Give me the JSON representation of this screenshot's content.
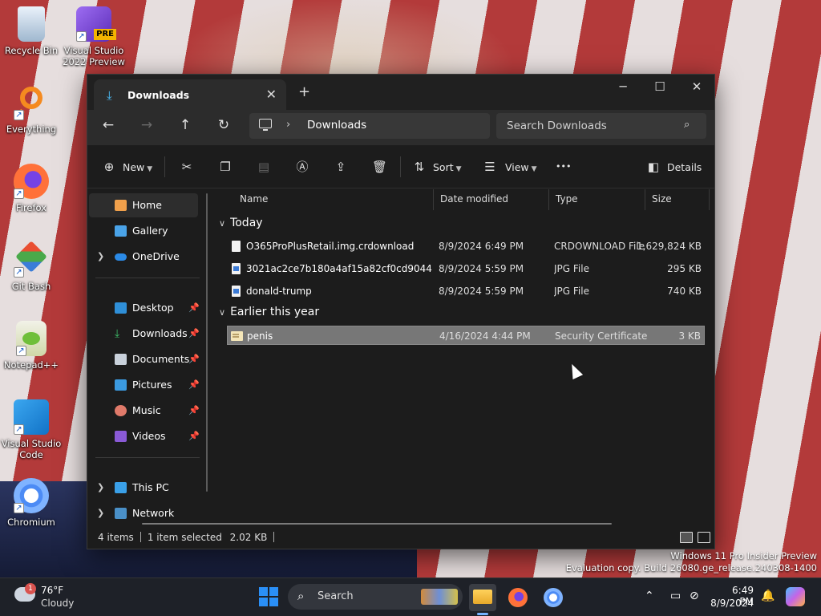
{
  "desktop": {
    "icons": [
      {
        "label": "Recycle Bin"
      },
      {
        "label": "Visual Studio 2022 Preview",
        "badge": "PRE"
      },
      {
        "label": "Everything"
      },
      {
        "label": "Firefox"
      },
      {
        "label": "Git Bash"
      },
      {
        "label": "Notepad++"
      },
      {
        "label": "Visual Studio Code"
      },
      {
        "label": "Chromium"
      }
    ]
  },
  "window": {
    "tab_title": "Downloads",
    "new_tab": "+",
    "controls": {
      "minimize": "─",
      "maximize": "☐",
      "close": "✕"
    },
    "nav": {
      "back": "←",
      "forward": "→",
      "up": "↑",
      "refresh": "↻"
    },
    "address": {
      "separator": "›",
      "current": "Downloads"
    },
    "search": {
      "placeholder": "Search Downloads"
    },
    "toolbar": {
      "new_label": "New",
      "sort_label": "Sort",
      "view_label": "View",
      "more_label": "•••",
      "details_label": "Details"
    },
    "sidebar": {
      "home": "Home",
      "gallery": "Gallery",
      "onedrive": "OneDrive",
      "desktop": "Desktop",
      "downloads": "Downloads",
      "documents": "Documents",
      "pictures": "Pictures",
      "music": "Music",
      "videos": "Videos",
      "this_pc": "This PC",
      "network": "Network"
    },
    "columns": {
      "name": "Name",
      "date": "Date modified",
      "type": "Type",
      "size": "Size"
    },
    "groups": [
      {
        "title": "Today",
        "files": [
          {
            "name": "O365ProPlusRetail.img.crdownload",
            "date": "8/9/2024 6:49 PM",
            "type": "CRDOWNLOAD File",
            "size": "1,629,824 KB"
          },
          {
            "name": "3021ac2ce7b180a4af15a82cf0cd9044",
            "date": "8/9/2024 5:59 PM",
            "type": "JPG File",
            "size": "295 KB"
          },
          {
            "name": "donald-trump",
            "date": "8/9/2024 5:59 PM",
            "type": "JPG File",
            "size": "740 KB"
          }
        ]
      },
      {
        "title": "Earlier this year",
        "files": [
          {
            "name": "penis",
            "date": "4/16/2024 4:44 PM",
            "type": "Security Certificate",
            "size": "3 KB"
          }
        ]
      }
    ],
    "status": {
      "items": "4 items",
      "selected": "1 item selected",
      "size": "2.02 KB"
    }
  },
  "watermark": {
    "line1": "Windows 11 Pro Insider Preview",
    "line2": "Evaluation copy. Build 26080.ge_release.240308-1400"
  },
  "taskbar": {
    "weather": {
      "temp": "76°F",
      "desc": "Cloudy",
      "badge": "1"
    },
    "search_label": "Search",
    "clock": {
      "time": "6:49 PM",
      "date": "8/9/2024"
    }
  }
}
